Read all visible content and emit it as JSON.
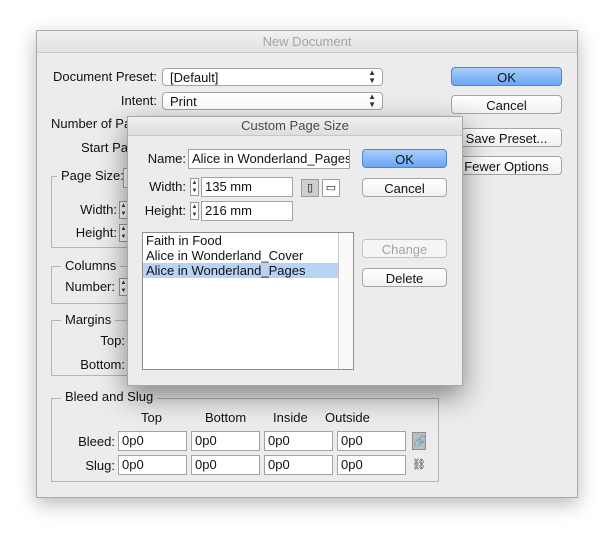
{
  "main": {
    "title": "New Document",
    "document_preset_label": "Document Preset:",
    "document_preset_value": "[Default]",
    "intent_label": "Intent:",
    "intent_value": "Print",
    "number_of_pages_label": "Number of Pa",
    "start_page_label": "Start Pa",
    "page_size_group_title": "Page Size:",
    "width_label": "Width:",
    "height_label": "Height:",
    "columns_group_title": "Columns",
    "number_label": "Number:",
    "margins_group_title": "Margins",
    "top_label": "Top:",
    "bottom_label": "Bottom:",
    "ok_label": "OK",
    "cancel_label": "Cancel",
    "save_preset_label": "Save Preset...",
    "fewer_options_label": "Fewer Options",
    "bleed_slug": {
      "title": "Bleed and Slug",
      "col_top": "Top",
      "col_bottom": "Bottom",
      "col_inside": "Inside",
      "col_outside": "Outside",
      "bleed_label": "Bleed:",
      "slug_label": "Slug:",
      "bleed": [
        "0p0",
        "0p0",
        "0p0",
        "0p0"
      ],
      "slug": [
        "0p0",
        "0p0",
        "0p0",
        "0p0"
      ]
    }
  },
  "custom": {
    "title": "Custom Page Size",
    "name_label": "Name:",
    "name_value": "Alice in Wonderland_Pages",
    "width_label": "Width:",
    "width_value": "135 mm",
    "height_label": "Height:",
    "height_value": "216 mm",
    "ok_label": "OK",
    "cancel_label": "Cancel",
    "change_label": "Change",
    "delete_label": "Delete",
    "list_items": [
      "Faith in Food",
      "Alice in Wonderland_Cover",
      "Alice in Wonderland_Pages"
    ],
    "selected_index": 2
  },
  "colors": {
    "default_button": "#6aa6f5",
    "selection": "#b8d4f5",
    "window_bg": "#ececec"
  },
  "icons": {
    "popup_arrows": "up-down-arrows-icon",
    "portrait": "portrait-orientation-icon",
    "landscape": "landscape-orientation-icon",
    "chain": "chain-link-icon",
    "broken_chain": "broken-chain-link-icon"
  }
}
